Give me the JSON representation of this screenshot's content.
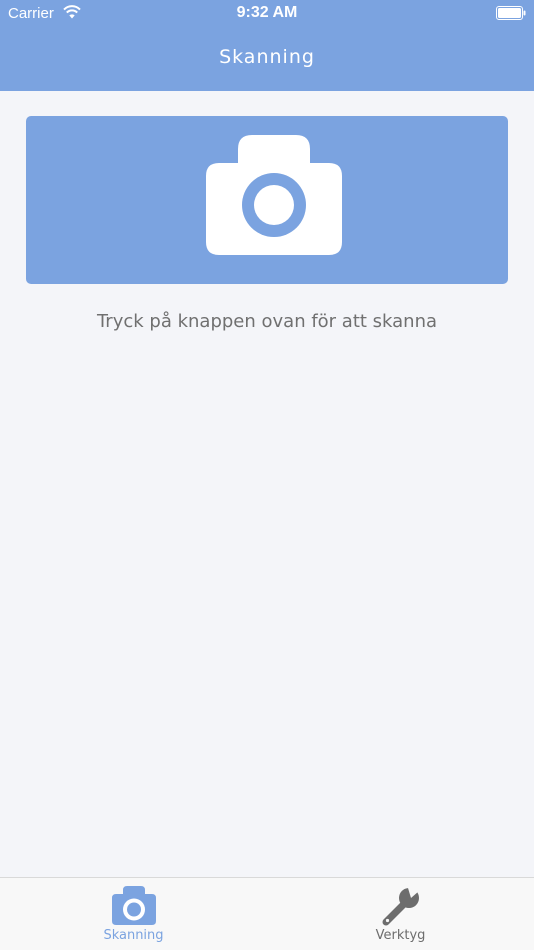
{
  "status_bar": {
    "carrier": "Carrier",
    "time": "9:32 AM"
  },
  "nav": {
    "title": "Skanning"
  },
  "main": {
    "scan_button_icon": "camera-icon",
    "instruction": "Tryck på knappen ovan för att skanna"
  },
  "tabs": [
    {
      "label": "Skanning",
      "icon": "camera-icon",
      "selected": true
    },
    {
      "label": "Verktyg",
      "icon": "wrench-icon",
      "selected": false
    }
  ],
  "colors": {
    "accent": "#7ba3e0",
    "background": "#f4f5f9",
    "inactive": "#6d6d6d"
  }
}
